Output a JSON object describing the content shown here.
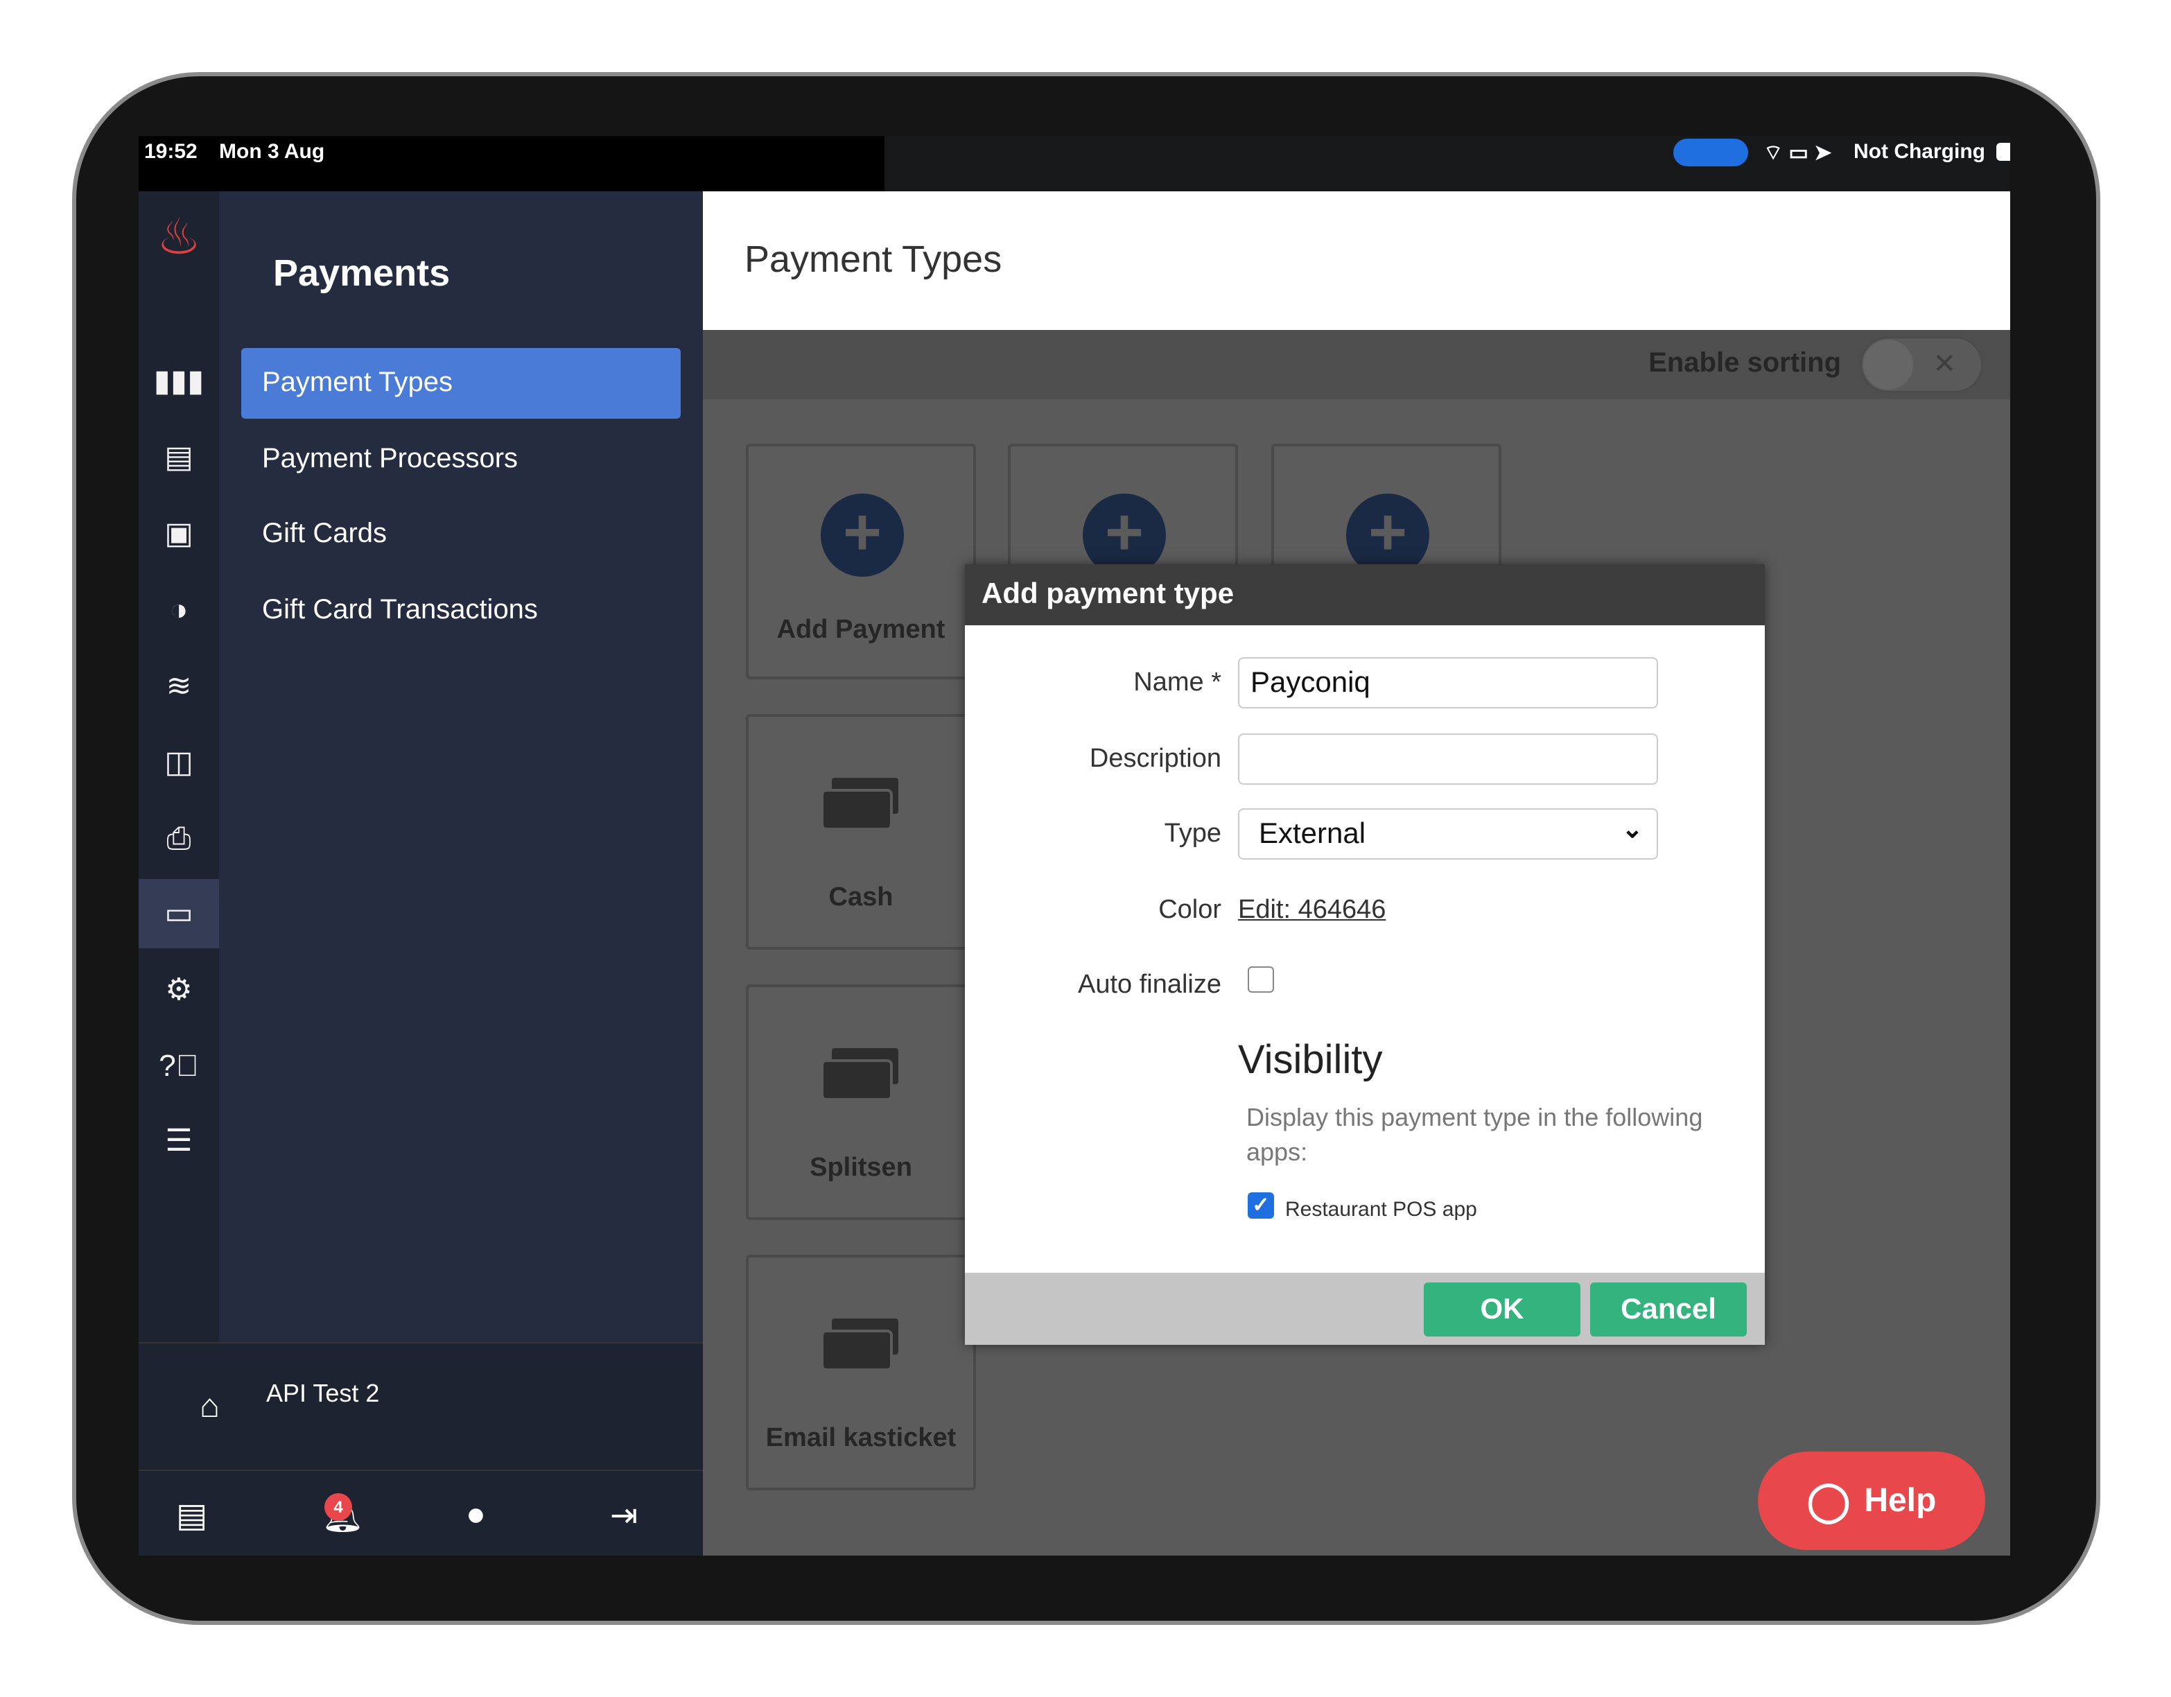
{
  "status_bar": {
    "time": "19:52",
    "date": "Mon 3 Aug",
    "battery": "Not Charging"
  },
  "sidebar": {
    "title": "Payments",
    "items": [
      {
        "label": "Payment Types",
        "active": true
      },
      {
        "label": "Payment Processors"
      },
      {
        "label": "Gift Cards"
      },
      {
        "label": "Gift Card Transactions"
      }
    ],
    "location": "API Test 2",
    "notification_count": "4"
  },
  "rail_icons": [
    "stats-icon",
    "clipboard-icon",
    "contact-card-icon",
    "dining-icon",
    "layers-icon",
    "devices-icon",
    "printer-icon",
    "payments-icon",
    "gear-icon",
    "help-icon",
    "server-icon"
  ],
  "main": {
    "title": "Payment Types",
    "enable_sorting_label": "Enable sorting",
    "sorting_enabled": false,
    "tiles": [
      {
        "label": "Add Payment"
      },
      {
        "label": ""
      },
      {
        "label": ""
      },
      {
        "label": "Cash"
      },
      {
        "label": "Splitsen"
      },
      {
        "label": "Email kasticket"
      }
    ]
  },
  "modal": {
    "title": "Add payment type",
    "name_label": "Name *",
    "name_value": "Payconiq",
    "description_label": "Description",
    "description_value": "",
    "type_label": "Type",
    "type_value": "External",
    "color_label": "Color",
    "color_link": "Edit: 464646",
    "auto_finalize_label": "Auto finalize",
    "auto_finalize": false,
    "visibility_title": "Visibility",
    "visibility_desc": "Display this payment type in the following apps:",
    "app_label": "Restaurant POS app",
    "app_checked": true,
    "ok": "OK",
    "cancel": "Cancel"
  },
  "help_label": "Help",
  "colors": {
    "accent": "#4a7bd6",
    "ok": "#34b37f",
    "help": "#e8474c",
    "sidebar": "#262c40"
  }
}
